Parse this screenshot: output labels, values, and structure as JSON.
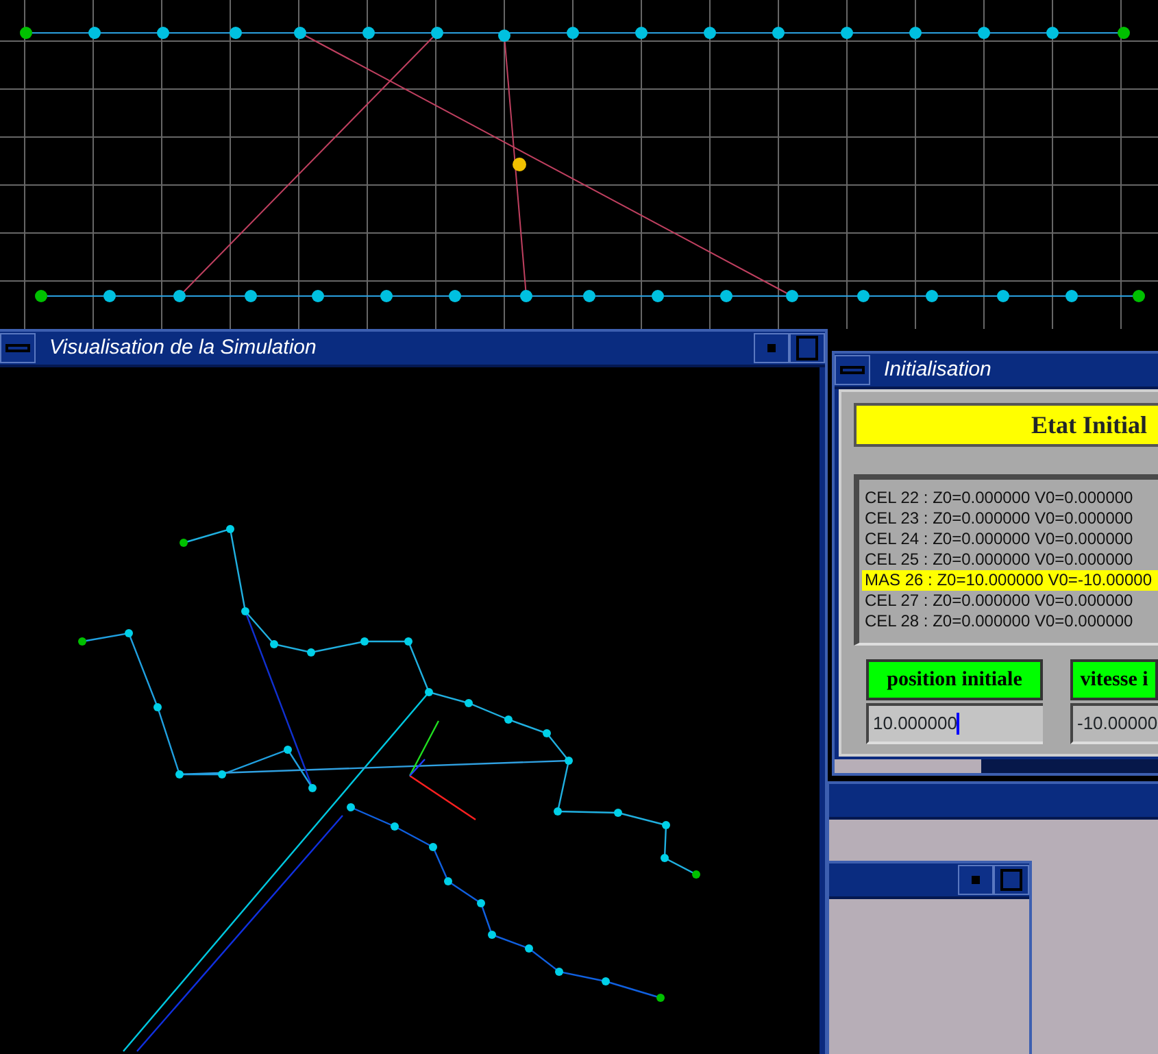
{
  "windows": [
    {
      "kind": "visualisation",
      "title": "Visualisation de la Simulation"
    },
    {
      "kind": "initialisation",
      "title": "Initialisation",
      "banner": "Etat Initial",
      "list": [
        {
          "text": "CEL 22 : Z0=0.000000 V0=0.000000",
          "selected": false
        },
        {
          "text": "CEL 23 : Z0=0.000000 V0=0.000000",
          "selected": false
        },
        {
          "text": "CEL 24 : Z0=0.000000 V0=0.000000",
          "selected": false
        },
        {
          "text": "CEL 25 : Z0=0.000000 V0=0.000000",
          "selected": false
        },
        {
          "text": "MAS 26 : Z0=10.000000 V0=-10.00000",
          "selected": true
        },
        {
          "text": "CEL 27 : Z0=0.000000 V0=0.000000",
          "selected": false
        },
        {
          "text": "CEL 28 : Z0=0.000000 V0=0.000000",
          "selected": false
        }
      ],
      "fields": [
        {
          "label": "position initiale",
          "value": "10.000000",
          "focused": true
        },
        {
          "label": "vitesse i",
          "value": "-10.00000",
          "focused": false
        }
      ]
    }
  ]
}
